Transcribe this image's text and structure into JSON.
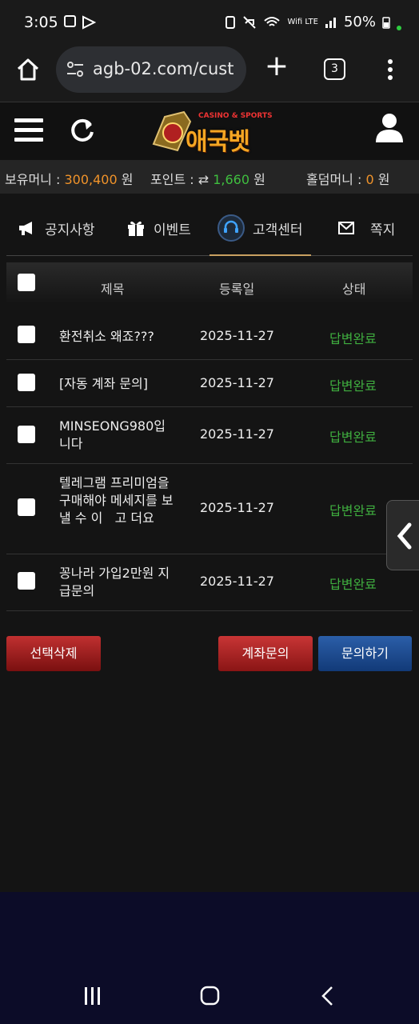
{
  "status_bar": {
    "time": "3:05",
    "battery": "50%",
    "network": "Wifi LTE"
  },
  "browser": {
    "url": "agb-02.com/cust",
    "tab_count": "3"
  },
  "header": {
    "logo_tagline": "CASINO & SPORTS",
    "logo_name": "애국벳"
  },
  "balance": {
    "money_label": "보유머니 :",
    "money_value": "300,400",
    "money_unit": "원",
    "point_label": "포인트 :",
    "point_value": "1,660",
    "point_unit": "원",
    "hold_label": "홀덤머니 :",
    "hold_value": "0",
    "hold_unit": "원"
  },
  "nav": {
    "tabs": [
      {
        "label": "공지사항",
        "icon": "megaphone-icon"
      },
      {
        "label": "이벤트",
        "icon": "gift-icon"
      },
      {
        "label": "고객센터",
        "icon": "headset-icon",
        "active": true
      },
      {
        "label": "쪽지",
        "icon": "envelope-icon"
      }
    ]
  },
  "table": {
    "headers": {
      "title": "제목",
      "date": "등록일",
      "status": "상태"
    },
    "rows": [
      {
        "title": "환전취소 왜죠???",
        "date": "2025-11-27",
        "status": "답변완료"
      },
      {
        "title": "[자동 계좌 문의]",
        "date": "2025-11-27",
        "status": "답변완료"
      },
      {
        "title": "MINSEONG980입니다",
        "date": "2025-11-27",
        "status": "답변완료"
      },
      {
        "title": "텔레그램 프리미엄을 구매해야 메세지를 보낼 수 이   고 더요",
        "date": "2025-11-27",
        "status": "답변완료"
      },
      {
        "title": "꽁나라 가입2만원 지급문의",
        "date": "2025-11-27",
        "status": "답변완료"
      }
    ]
  },
  "buttons": {
    "delete_selected": "선택삭제",
    "account_inquiry": "계좌문의",
    "new_inquiry": "문의하기"
  },
  "colors": {
    "accent_orange": "#f0932a",
    "status_green": "#3fae3f",
    "btn_red": "#a02020",
    "btn_blue": "#1f4c92"
  }
}
